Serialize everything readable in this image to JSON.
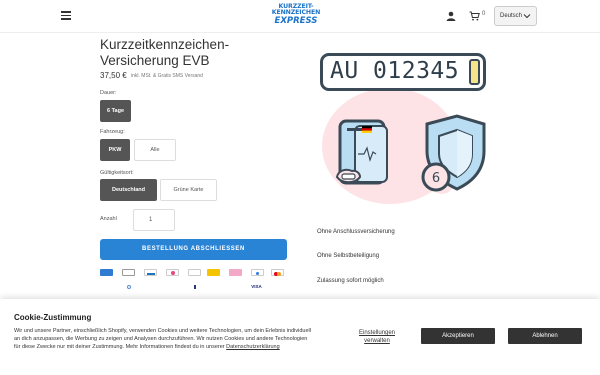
{
  "header": {
    "logo_line1": "KURZZEIT-",
    "logo_line2": "KENNZEICHEN",
    "logo_line3": "EXPRESS",
    "cart_count": "0",
    "language": "Deutsch"
  },
  "product": {
    "title": "Kurzzeitkennzeichen-Versicherung EVB",
    "price": "37,50 €",
    "price_note": "inkl. MSt. & Gratis SMS Versand",
    "duration_label": "Dauer:",
    "duration_options": [
      "6 Tage"
    ],
    "vehicle_label": "Fahrzeug:",
    "vehicle_options": [
      "PKW",
      "Alle"
    ],
    "validity_label": "Gültigkeitsort:",
    "validity_options": [
      "Deutschland",
      "Grüne Karte"
    ],
    "quantity_label": "Anzahl",
    "quantity_value": "1",
    "checkout_label": "BESTELLUNG ABSCHLIESSEN"
  },
  "payments": [
    "Amex",
    "Apple Pay",
    "Bancontact",
    "Diners",
    "Google Pay",
    "Klarna",
    "Maestro",
    "Mastercard",
    "Shop Pay",
    "PayPal",
    "Visa"
  ],
  "illustration": {
    "plate_text": "AU 012345",
    "badge_number": "6",
    "flag_colors": [
      "#000000",
      "#dd0000",
      "#ffce00"
    ]
  },
  "features": [
    "Ohne Anschlussversicherung",
    "Ohne Selbstbeteiligung",
    "Zulassung sofort möglich"
  ],
  "cookie": {
    "title": "Cookie-Zustimmung",
    "text": "Wir und unsere Partner, einschließlich Shopify, verwenden Cookies und weitere Technologien, um dein Erlebnis individuell an dich anzupassen, die Werbung zu zeigen und Analysen durchzuführen. Wir nutzen Cookies und andere Technologien für diese Zwecke nur mit deiner Zustimmung. Mehr Informationen findest du in unserer",
    "link": "Datenschutzerklärung",
    "settings": "Einstellungen verwalten",
    "accept": "Akzeptieren",
    "reject": "Ablehnen"
  },
  "colors": {
    "accent": "#2a84d6",
    "selected_option": "#555555",
    "illustration_dark": "#3a4a56",
    "illustration_blue": "#b9ddf2",
    "illustration_pink": "#fde3e6"
  }
}
